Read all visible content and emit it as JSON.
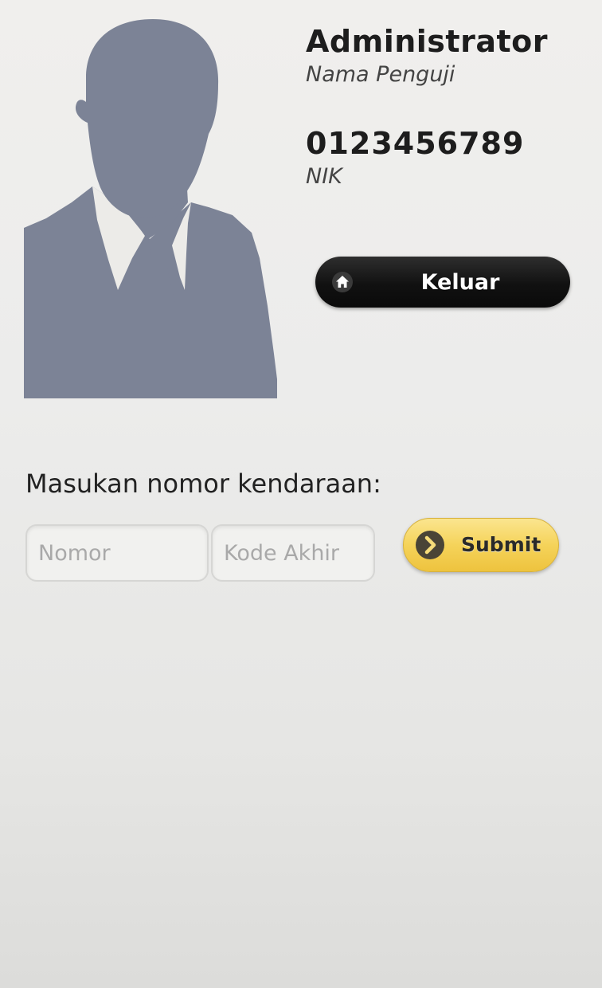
{
  "profile": {
    "name": "Administrator",
    "name_caption": "Nama Penguji",
    "nik": "0123456789",
    "nik_caption": "NIK"
  },
  "logout": {
    "label": "Keluar",
    "icon": "home-icon"
  },
  "form": {
    "prompt": "Masukan nomor kendaraan:",
    "nomor_placeholder": "Nomor",
    "nomor_value": "",
    "kode_placeholder": "Kode Akhir",
    "kode_value": "",
    "submit_label": "Submit",
    "submit_icon": "arrow-right-circle-icon"
  },
  "colors": {
    "avatar": "#7c8396",
    "logout_bg": "#111111",
    "submit_bg": "#f5d35a"
  }
}
